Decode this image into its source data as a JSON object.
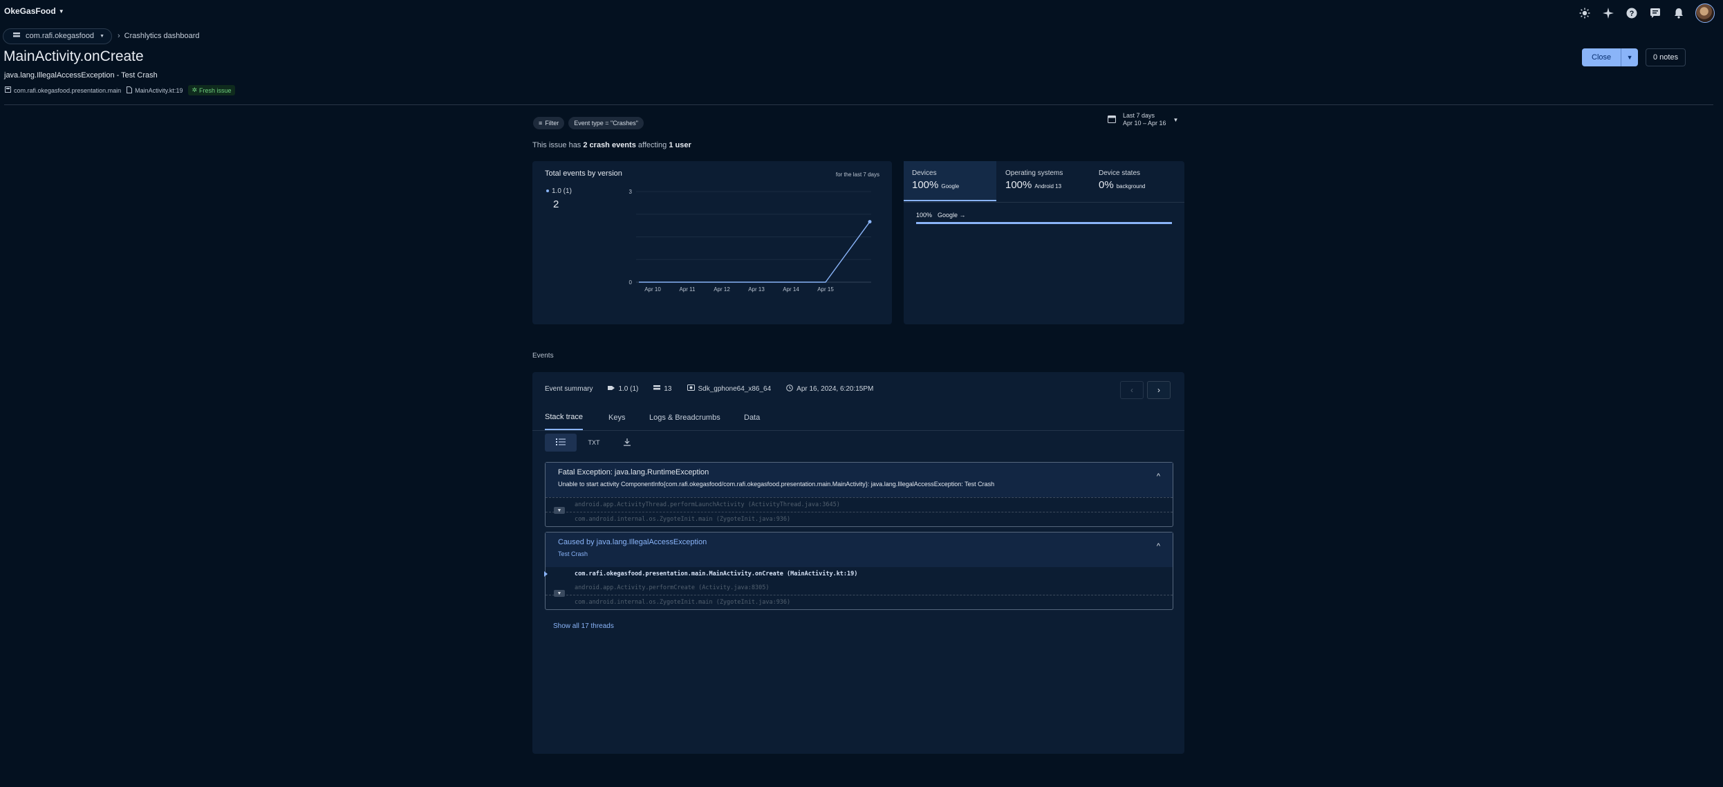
{
  "top_bar": {
    "project_name": "OkeGasFood",
    "icons": [
      "brightness-icon",
      "sparkle-icon",
      "help-icon",
      "feedback-icon",
      "notifications-icon",
      "avatar"
    ]
  },
  "breadcrumb": {
    "app_id": "com.rafi.okegasfood",
    "current": "Crashlytics dashboard"
  },
  "issue": {
    "title": "MainActivity.onCreate",
    "subtitle": "java.lang.IllegalAccessException - Test Crash",
    "package": "com.rafi.okegasfood.presentation.main",
    "file": "MainActivity.kt:19",
    "badge": "Fresh issue"
  },
  "actions": {
    "close_label": "Close",
    "notes_label": "0 notes"
  },
  "filters": {
    "filter_label": "Filter",
    "event_type": "Event type = \"Crashes\"",
    "date_range_title": "Last 7 days",
    "date_range_dates": "Apr 10 – Apr 16"
  },
  "summary": {
    "prefix": "This issue has ",
    "events": "2 crash events",
    "middle": " affecting ",
    "users": "1 user"
  },
  "chart_card": {
    "title": "Total events by version",
    "period": "for the last 7 days",
    "legend_label": "1.0 (1)",
    "legend_count": "2"
  },
  "chart_data": {
    "type": "line",
    "x": [
      "Apr 10",
      "Apr 11",
      "Apr 12",
      "Apr 13",
      "Apr 14",
      "Apr 15",
      "Apr 16"
    ],
    "series": [
      {
        "name": "1.0 (1)",
        "values": [
          0,
          0,
          0,
          0,
          0,
          0,
          2
        ]
      }
    ],
    "ytick_labels": [
      "0",
      "3"
    ],
    "ylim": [
      0,
      3
    ],
    "color": "#8ab4f8"
  },
  "breakdown": {
    "tabs": [
      {
        "label": "Devices",
        "value": "100%",
        "sub": "Google"
      },
      {
        "label": "Operating systems",
        "value": "100%",
        "sub": "Android 13"
      },
      {
        "label": "Device states",
        "value": "0%",
        "sub": "background"
      }
    ],
    "row_percent": "100%",
    "row_label": "Google →",
    "row_fraction": 1.0
  },
  "events": {
    "heading": "Events",
    "summary_label": "Event summary",
    "version": "1.0 (1)",
    "count": "13",
    "device": "Sdk_gphone64_x86_64",
    "timestamp": "Apr 16, 2024, 6:20:15PM",
    "tabs": [
      "Stack trace",
      "Keys",
      "Logs & Breadcrumbs",
      "Data"
    ],
    "view_txt": "TXT"
  },
  "stack": {
    "fatal_title": "Fatal Exception: java.lang.RuntimeException",
    "fatal_message": "Unable to start activity ComponentInfo{com.rafi.okegasfood/com.rafi.okegasfood.presentation.main.MainActivity}: java.lang.IllegalAccessException: Test Crash",
    "fatal_frames": [
      "android.app.ActivityThread.performLaunchActivity (ActivityThread.java:3645)",
      "com.android.internal.os.ZygoteInit.main (ZygoteInit.java:936)"
    ],
    "cause_title": "Caused by java.lang.IllegalAccessException",
    "cause_message": "Test Crash",
    "cause_frames": [
      "com.rafi.okegasfood.presentation.main.MainActivity.onCreate (MainActivity.kt:19)",
      "android.app.Activity.performCreate (Activity.java:8305)",
      "com.android.internal.os.ZygoteInit.main (ZygoteInit.java:936)"
    ],
    "show_threads": "Show all 17 threads"
  }
}
